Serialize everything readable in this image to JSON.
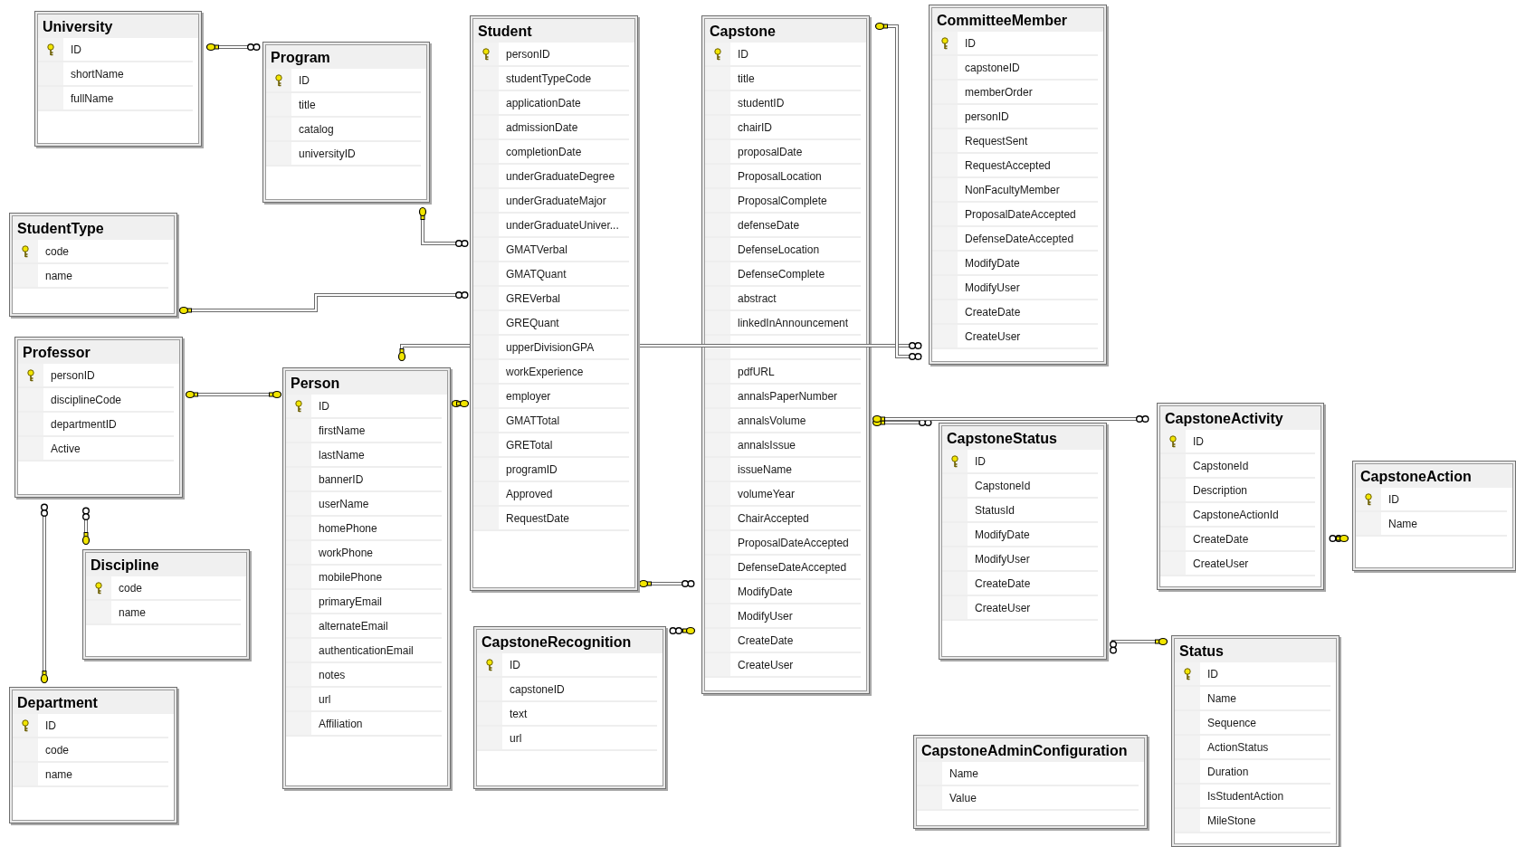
{
  "tables": [
    {
      "name": "University",
      "columns": [
        {
          "name": "ID",
          "primary_key": true
        },
        {
          "name": "shortName",
          "primary_key": false
        },
        {
          "name": "fullName",
          "primary_key": false
        }
      ]
    },
    {
      "name": "Program",
      "columns": [
        {
          "name": "ID",
          "primary_key": true
        },
        {
          "name": "title",
          "primary_key": false
        },
        {
          "name": "catalog",
          "primary_key": false
        },
        {
          "name": "universityID",
          "primary_key": false
        }
      ]
    },
    {
      "name": "Student",
      "columns": [
        {
          "name": "personID",
          "primary_key": true
        },
        {
          "name": "studentTypeCode",
          "primary_key": false
        },
        {
          "name": "applicationDate",
          "primary_key": false
        },
        {
          "name": "admissionDate",
          "primary_key": false
        },
        {
          "name": "completionDate",
          "primary_key": false
        },
        {
          "name": "underGraduateDegree",
          "primary_key": false
        },
        {
          "name": "underGraduateMajor",
          "primary_key": false
        },
        {
          "name": "underGraduateUniver...",
          "primary_key": false
        },
        {
          "name": "GMATVerbal",
          "primary_key": false
        },
        {
          "name": "GMATQuant",
          "primary_key": false
        },
        {
          "name": "GREVerbal",
          "primary_key": false
        },
        {
          "name": "GREQuant",
          "primary_key": false
        },
        {
          "name": "upperDivisionGPA",
          "primary_key": false
        },
        {
          "name": "workExperience",
          "primary_key": false
        },
        {
          "name": "employer",
          "primary_key": false
        },
        {
          "name": "GMATTotal",
          "primary_key": false
        },
        {
          "name": "GRETotal",
          "primary_key": false
        },
        {
          "name": "programID",
          "primary_key": false
        },
        {
          "name": "Approved",
          "primary_key": false
        },
        {
          "name": "RequestDate",
          "primary_key": false
        }
      ]
    },
    {
      "name": "Capstone",
      "columns": [
        {
          "name": "ID",
          "primary_key": true
        },
        {
          "name": "title",
          "primary_key": false
        },
        {
          "name": "studentID",
          "primary_key": false
        },
        {
          "name": "chairID",
          "primary_key": false
        },
        {
          "name": "proposalDate",
          "primary_key": false
        },
        {
          "name": "ProposalLocation",
          "primary_key": false
        },
        {
          "name": "ProposalComplete",
          "primary_key": false
        },
        {
          "name": "defenseDate",
          "primary_key": false
        },
        {
          "name": "DefenseLocation",
          "primary_key": false
        },
        {
          "name": "DefenseComplete",
          "primary_key": false
        },
        {
          "name": "abstract",
          "primary_key": false
        },
        {
          "name": "linkedInAnnouncement",
          "primary_key": false
        },
        {
          "primary_key": false
        },
        {
          "name": "pdfURL",
          "primary_key": false
        },
        {
          "name": "annalsPaperNumber",
          "primary_key": false
        },
        {
          "name": "annalsVolume",
          "primary_key": false
        },
        {
          "name": "annalsIssue",
          "primary_key": false
        },
        {
          "name": "issueName",
          "primary_key": false
        },
        {
          "name": "volumeYear",
          "primary_key": false
        },
        {
          "name": "ChairAccepted",
          "primary_key": false
        },
        {
          "name": "ProposalDateAccepted",
          "primary_key": false
        },
        {
          "name": "DefenseDateAccepted",
          "primary_key": false
        },
        {
          "name": "ModifyDate",
          "primary_key": false
        },
        {
          "name": "ModifyUser",
          "primary_key": false
        },
        {
          "name": "CreateDate",
          "primary_key": false
        },
        {
          "name": "CreateUser",
          "primary_key": false
        }
      ]
    },
    {
      "name": "CommitteeMember",
      "columns": [
        {
          "name": "ID",
          "primary_key": true
        },
        {
          "name": "capstoneID",
          "primary_key": false
        },
        {
          "name": "memberOrder",
          "primary_key": false
        },
        {
          "name": "personID",
          "primary_key": false
        },
        {
          "name": "RequestSent",
          "primary_key": false
        },
        {
          "name": "RequestAccepted",
          "primary_key": false
        },
        {
          "name": "NonFacultyMember",
          "primary_key": false
        },
        {
          "name": "ProposalDateAccepted",
          "primary_key": false
        },
        {
          "name": "DefenseDateAccepted",
          "primary_key": false
        },
        {
          "name": "ModifyDate",
          "primary_key": false
        },
        {
          "name": "ModifyUser",
          "primary_key": false
        },
        {
          "name": "CreateDate",
          "primary_key": false
        },
        {
          "name": "CreateUser",
          "primary_key": false
        }
      ]
    },
    {
      "name": "StudentType",
      "columns": [
        {
          "name": "code",
          "primary_key": true
        },
        {
          "name": "name",
          "primary_key": false
        }
      ]
    },
    {
      "name": "Professor",
      "columns": [
        {
          "name": "personID",
          "primary_key": true
        },
        {
          "name": "disciplineCode",
          "primary_key": false
        },
        {
          "name": "departmentID",
          "primary_key": false
        },
        {
          "name": "Active",
          "primary_key": false
        }
      ]
    },
    {
      "name": "Person",
      "columns": [
        {
          "name": "ID",
          "primary_key": true
        },
        {
          "name": "firstName",
          "primary_key": false
        },
        {
          "name": "lastName",
          "primary_key": false
        },
        {
          "name": "bannerID",
          "primary_key": false
        },
        {
          "name": "userName",
          "primary_key": false
        },
        {
          "name": "homePhone",
          "primary_key": false
        },
        {
          "name": "workPhone",
          "primary_key": false
        },
        {
          "name": "mobilePhone",
          "primary_key": false
        },
        {
          "name": "primaryEmail",
          "primary_key": false
        },
        {
          "name": "alternateEmail",
          "primary_key": false
        },
        {
          "name": "authenticationEmail",
          "primary_key": false
        },
        {
          "name": "notes",
          "primary_key": false
        },
        {
          "name": "url",
          "primary_key": false
        },
        {
          "name": "Affiliation",
          "primary_key": false
        }
      ]
    },
    {
      "name": "CapstoneStatus",
      "columns": [
        {
          "name": "ID",
          "primary_key": true
        },
        {
          "name": "CapstoneId",
          "primary_key": false
        },
        {
          "name": "StatusId",
          "primary_key": false
        },
        {
          "name": "ModifyDate",
          "primary_key": false
        },
        {
          "name": "ModifyUser",
          "primary_key": false
        },
        {
          "name": "CreateDate",
          "primary_key": false
        },
        {
          "name": "CreateUser",
          "primary_key": false
        }
      ]
    },
    {
      "name": "CapstoneActivity",
      "columns": [
        {
          "name": "ID",
          "primary_key": true
        },
        {
          "name": "CapstoneId",
          "primary_key": false
        },
        {
          "name": "Description",
          "primary_key": false
        },
        {
          "name": "CapstoneActionId",
          "primary_key": false
        },
        {
          "name": "CreateDate",
          "primary_key": false
        },
        {
          "name": "CreateUser",
          "primary_key": false
        }
      ]
    },
    {
      "name": "CapstoneAction",
      "columns": [
        {
          "name": "ID",
          "primary_key": true
        },
        {
          "name": "Name",
          "primary_key": false
        }
      ]
    },
    {
      "name": "Discipline",
      "columns": [
        {
          "name": "code",
          "primary_key": true
        },
        {
          "name": "name",
          "primary_key": false
        }
      ]
    },
    {
      "name": "Department",
      "columns": [
        {
          "name": "ID",
          "primary_key": true
        },
        {
          "name": "code",
          "primary_key": false
        },
        {
          "name": "name",
          "primary_key": false
        }
      ]
    },
    {
      "name": "CapstoneRecognition",
      "columns": [
        {
          "name": "ID",
          "primary_key": true
        },
        {
          "name": "capstoneID",
          "primary_key": false
        },
        {
          "name": "text",
          "primary_key": false
        },
        {
          "name": "url",
          "primary_key": false
        }
      ]
    },
    {
      "name": "CapstoneAdminConfiguration",
      "columns": [
        {
          "name": "Name",
          "primary_key": false
        },
        {
          "name": "Value",
          "primary_key": false
        }
      ]
    },
    {
      "name": "Status",
      "columns": [
        {
          "name": "ID",
          "primary_key": true
        },
        {
          "name": "Name",
          "primary_key": false
        },
        {
          "name": "Sequence",
          "primary_key": false
        },
        {
          "name": "ActionStatus",
          "primary_key": false
        },
        {
          "name": "Duration",
          "primary_key": false
        },
        {
          "name": "IsStudentAction",
          "primary_key": false
        },
        {
          "name": "MileStone",
          "primary_key": false
        }
      ]
    }
  ]
}
